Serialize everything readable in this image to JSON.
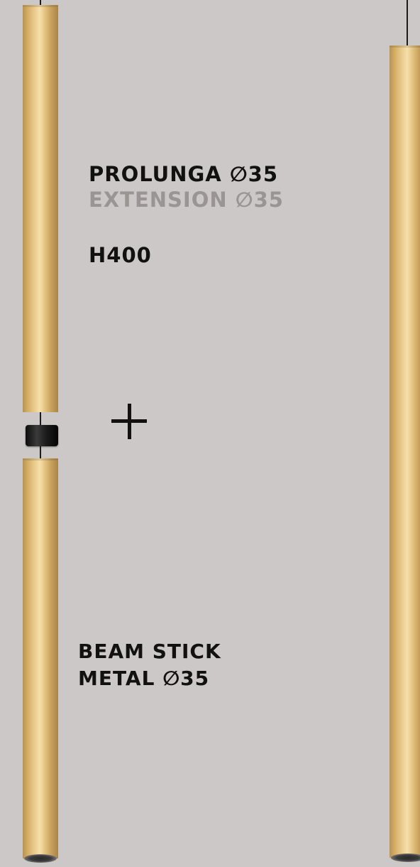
{
  "extension": {
    "title_it": "PROLUNGA ∅35",
    "title_en": "EXTENSION ∅35",
    "height": "H400"
  },
  "product": {
    "line1": "BEAM STICK",
    "line2": "METAL ∅35"
  },
  "colors": {
    "background": "#cdc8c8",
    "primary_text": "#111111",
    "secondary_text": "#9a9592",
    "brass": "#e9c98a"
  },
  "icons": [
    "plus-icon"
  ]
}
